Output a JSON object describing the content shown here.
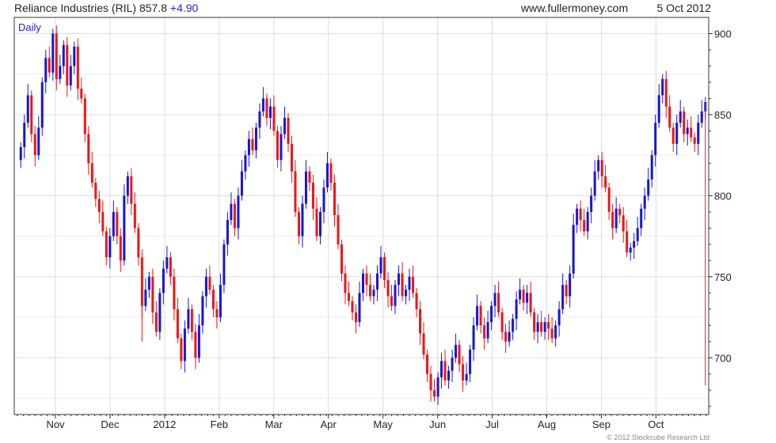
{
  "header": {
    "title": "Reliance Industries (RIL) 857.8",
    "change": "+4.90",
    "site": "www.fullermoney.com",
    "date": "5 Oct 2012"
  },
  "footer": {
    "copyright": "© 2012 Stockcube Research Ltd"
  },
  "colors": {
    "up": "#1515dd",
    "down": "#ee1515",
    "grid": "#dcdcdc",
    "axis": "#333333"
  },
  "chart_data": {
    "type": "candlestick",
    "interval_label": "Daily",
    "y_ticks": [
      700,
      750,
      800,
      850,
      900
    ],
    "ylim": [
      665,
      910
    ],
    "x_ticks": [
      "Nov",
      "Dec",
      "2012",
      "Feb",
      "Mar",
      "Apr",
      "May",
      "Jun",
      "Jul",
      "Aug",
      "Sep",
      "Oct"
    ],
    "grid": true,
    "series": [
      {
        "close": 830,
        "dir": "up"
      },
      {
        "close": 845,
        "dir": "up"
      },
      {
        "close": 862,
        "dir": "up"
      },
      {
        "close": 838,
        "dir": "down"
      },
      {
        "close": 825,
        "dir": "down"
      },
      {
        "close": 842,
        "dir": "up"
      },
      {
        "close": 870,
        "dir": "up"
      },
      {
        "close": 885,
        "dir": "up"
      },
      {
        "close": 876,
        "dir": "down"
      },
      {
        "close": 900,
        "dir": "up"
      },
      {
        "close": 872,
        "dir": "down"
      },
      {
        "close": 880,
        "dir": "up"
      },
      {
        "close": 893,
        "dir": "up"
      },
      {
        "close": 868,
        "dir": "down"
      },
      {
        "close": 880,
        "dir": "up"
      },
      {
        "close": 892,
        "dir": "up"
      },
      {
        "close": 866,
        "dir": "down"
      },
      {
        "close": 860,
        "dir": "down"
      },
      {
        "close": 838,
        "dir": "down"
      },
      {
        "close": 820,
        "dir": "down"
      },
      {
        "close": 808,
        "dir": "down"
      },
      {
        "close": 798,
        "dir": "down"
      },
      {
        "close": 790,
        "dir": "down"
      },
      {
        "close": 778,
        "dir": "down"
      },
      {
        "close": 762,
        "dir": "down"
      },
      {
        "close": 775,
        "dir": "up"
      },
      {
        "close": 790,
        "dir": "up"
      },
      {
        "close": 775,
        "dir": "down"
      },
      {
        "close": 760,
        "dir": "down"
      },
      {
        "close": 800,
        "dir": "up"
      },
      {
        "close": 812,
        "dir": "up"
      },
      {
        "close": 795,
        "dir": "down"
      },
      {
        "close": 780,
        "dir": "down"
      },
      {
        "close": 762,
        "dir": "down"
      },
      {
        "close": 732,
        "dir": "down"
      },
      {
        "close": 742,
        "dir": "up"
      },
      {
        "close": 750,
        "dir": "up"
      },
      {
        "close": 728,
        "dir": "down"
      },
      {
        "close": 716,
        "dir": "down"
      },
      {
        "close": 740,
        "dir": "up"
      },
      {
        "close": 755,
        "dir": "up"
      },
      {
        "close": 762,
        "dir": "up"
      },
      {
        "close": 750,
        "dir": "down"
      },
      {
        "close": 730,
        "dir": "down"
      },
      {
        "close": 712,
        "dir": "down"
      },
      {
        "close": 698,
        "dir": "down"
      },
      {
        "close": 718,
        "dir": "up"
      },
      {
        "close": 730,
        "dir": "up"
      },
      {
        "close": 716,
        "dir": "down"
      },
      {
        "close": 700,
        "dir": "down"
      },
      {
        "close": 720,
        "dir": "up"
      },
      {
        "close": 738,
        "dir": "up"
      },
      {
        "close": 750,
        "dir": "up"
      },
      {
        "close": 742,
        "dir": "down"
      },
      {
        "close": 730,
        "dir": "down"
      },
      {
        "close": 725,
        "dir": "down"
      },
      {
        "close": 745,
        "dir": "up"
      },
      {
        "close": 770,
        "dir": "up"
      },
      {
        "close": 785,
        "dir": "up"
      },
      {
        "close": 795,
        "dir": "up"
      },
      {
        "close": 780,
        "dir": "down"
      },
      {
        "close": 800,
        "dir": "up"
      },
      {
        "close": 815,
        "dir": "up"
      },
      {
        "close": 825,
        "dir": "up"
      },
      {
        "close": 835,
        "dir": "up"
      },
      {
        "close": 828,
        "dir": "down"
      },
      {
        "close": 842,
        "dir": "up"
      },
      {
        "close": 852,
        "dir": "up"
      },
      {
        "close": 860,
        "dir": "up"
      },
      {
        "close": 848,
        "dir": "down"
      },
      {
        "close": 855,
        "dir": "up"
      },
      {
        "close": 840,
        "dir": "down"
      },
      {
        "close": 822,
        "dir": "down"
      },
      {
        "close": 838,
        "dir": "up"
      },
      {
        "close": 848,
        "dir": "up"
      },
      {
        "close": 832,
        "dir": "down"
      },
      {
        "close": 815,
        "dir": "down"
      },
      {
        "close": 790,
        "dir": "down"
      },
      {
        "close": 775,
        "dir": "down"
      },
      {
        "close": 795,
        "dir": "up"
      },
      {
        "close": 815,
        "dir": "up"
      },
      {
        "close": 808,
        "dir": "down"
      },
      {
        "close": 792,
        "dir": "down"
      },
      {
        "close": 775,
        "dir": "down"
      },
      {
        "close": 790,
        "dir": "up"
      },
      {
        "close": 805,
        "dir": "up"
      },
      {
        "close": 820,
        "dir": "up"
      },
      {
        "close": 808,
        "dir": "down"
      },
      {
        "close": 788,
        "dir": "down"
      },
      {
        "close": 770,
        "dir": "down"
      },
      {
        "close": 752,
        "dir": "down"
      },
      {
        "close": 740,
        "dir": "down"
      },
      {
        "close": 735,
        "dir": "down"
      },
      {
        "close": 728,
        "dir": "down"
      },
      {
        "close": 722,
        "dir": "down"
      },
      {
        "close": 740,
        "dir": "up"
      },
      {
        "close": 752,
        "dir": "up"
      },
      {
        "close": 745,
        "dir": "down"
      },
      {
        "close": 738,
        "dir": "down"
      },
      {
        "close": 742,
        "dir": "up"
      },
      {
        "close": 752,
        "dir": "up"
      },
      {
        "close": 762,
        "dir": "up"
      },
      {
        "close": 748,
        "dir": "down"
      },
      {
        "close": 738,
        "dir": "down"
      },
      {
        "close": 732,
        "dir": "down"
      },
      {
        "close": 745,
        "dir": "up"
      },
      {
        "close": 752,
        "dir": "up"
      },
      {
        "close": 738,
        "dir": "down"
      },
      {
        "close": 742,
        "dir": "up"
      },
      {
        "close": 750,
        "dir": "up"
      },
      {
        "close": 740,
        "dir": "down"
      },
      {
        "close": 730,
        "dir": "down"
      },
      {
        "close": 715,
        "dir": "down"
      },
      {
        "close": 702,
        "dir": "down"
      },
      {
        "close": 690,
        "dir": "down"
      },
      {
        "close": 680,
        "dir": "down"
      },
      {
        "close": 676,
        "dir": "down"
      },
      {
        "close": 688,
        "dir": "up"
      },
      {
        "close": 698,
        "dir": "up"
      },
      {
        "close": 686,
        "dir": "down"
      },
      {
        "close": 692,
        "dir": "up"
      },
      {
        "close": 700,
        "dir": "up"
      },
      {
        "close": 708,
        "dir": "up"
      },
      {
        "close": 696,
        "dir": "down"
      },
      {
        "close": 686,
        "dir": "down"
      },
      {
        "close": 690,
        "dir": "up"
      },
      {
        "close": 705,
        "dir": "up"
      },
      {
        "close": 720,
        "dir": "up"
      },
      {
        "close": 732,
        "dir": "up"
      },
      {
        "close": 720,
        "dir": "down"
      },
      {
        "close": 712,
        "dir": "down"
      },
      {
        "close": 722,
        "dir": "up"
      },
      {
        "close": 732,
        "dir": "up"
      },
      {
        "close": 740,
        "dir": "up"
      },
      {
        "close": 728,
        "dir": "down"
      },
      {
        "close": 716,
        "dir": "down"
      },
      {
        "close": 710,
        "dir": "down"
      },
      {
        "close": 716,
        "dir": "up"
      },
      {
        "close": 724,
        "dir": "up"
      },
      {
        "close": 736,
        "dir": "up"
      },
      {
        "close": 742,
        "dir": "up"
      },
      {
        "close": 734,
        "dir": "down"
      },
      {
        "close": 740,
        "dir": "up"
      },
      {
        "close": 728,
        "dir": "down"
      },
      {
        "close": 716,
        "dir": "down"
      },
      {
        "close": 722,
        "dir": "up"
      },
      {
        "close": 716,
        "dir": "down"
      },
      {
        "close": 722,
        "dir": "up"
      },
      {
        "close": 718,
        "dir": "down"
      },
      {
        "close": 712,
        "dir": "down"
      },
      {
        "close": 720,
        "dir": "up"
      },
      {
        "close": 730,
        "dir": "up"
      },
      {
        "close": 745,
        "dir": "up"
      },
      {
        "close": 738,
        "dir": "down"
      },
      {
        "close": 752,
        "dir": "up"
      },
      {
        "close": 782,
        "dir": "up"
      },
      {
        "close": 792,
        "dir": "up"
      },
      {
        "close": 785,
        "dir": "down"
      },
      {
        "close": 778,
        "dir": "down"
      },
      {
        "close": 790,
        "dir": "up"
      },
      {
        "close": 800,
        "dir": "up"
      },
      {
        "close": 815,
        "dir": "up"
      },
      {
        "close": 822,
        "dir": "up"
      },
      {
        "close": 812,
        "dir": "down"
      },
      {
        "close": 805,
        "dir": "down"
      },
      {
        "close": 790,
        "dir": "down"
      },
      {
        "close": 780,
        "dir": "down"
      },
      {
        "close": 792,
        "dir": "up"
      },
      {
        "close": 788,
        "dir": "down"
      },
      {
        "close": 778,
        "dir": "down"
      },
      {
        "close": 765,
        "dir": "down"
      },
      {
        "close": 768,
        "dir": "up"
      },
      {
        "close": 772,
        "dir": "up"
      },
      {
        "close": 780,
        "dir": "up"
      },
      {
        "close": 792,
        "dir": "up"
      },
      {
        "close": 800,
        "dir": "up"
      },
      {
        "close": 810,
        "dir": "up"
      },
      {
        "close": 825,
        "dir": "up"
      },
      {
        "close": 845,
        "dir": "up"
      },
      {
        "close": 862,
        "dir": "up"
      },
      {
        "close": 872,
        "dir": "up"
      },
      {
        "close": 855,
        "dir": "down"
      },
      {
        "close": 842,
        "dir": "down"
      },
      {
        "close": 832,
        "dir": "down"
      },
      {
        "close": 845,
        "dir": "up"
      },
      {
        "close": 852,
        "dir": "up"
      },
      {
        "close": 838,
        "dir": "down"
      },
      {
        "close": 842,
        "dir": "up"
      },
      {
        "close": 836,
        "dir": "down"
      },
      {
        "close": 832,
        "dir": "down"
      },
      {
        "close": 845,
        "dir": "up"
      },
      {
        "close": 852,
        "dir": "up"
      },
      {
        "close": 857.8,
        "dir": "up"
      }
    ]
  }
}
